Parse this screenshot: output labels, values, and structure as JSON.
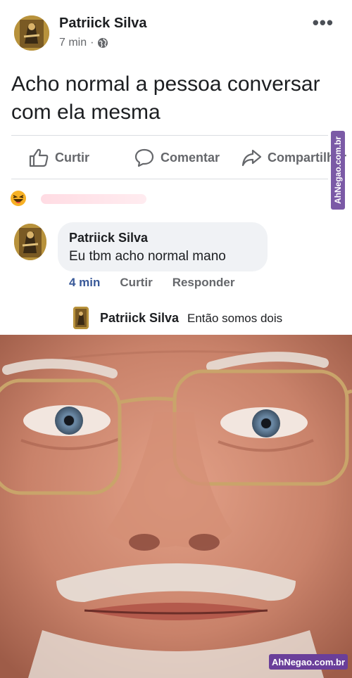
{
  "post": {
    "author": "Patriick Silva",
    "time": "7 min",
    "separator": "·",
    "text": "Acho normal a pessoa conversar com ela mesma",
    "more_icon": "more-dots-icon",
    "privacy_icon": "globe-icon"
  },
  "actions": {
    "like_label": "Curtir",
    "comment_label": "Comentar",
    "share_label": "Compartilhar"
  },
  "reactions": {
    "icon": "haha-icon"
  },
  "comment": {
    "author": "Patriick Silva",
    "text": "Eu tbm acho normal mano",
    "time": "4 min",
    "like_label": "Curtir",
    "reply_label": "Responder"
  },
  "reply": {
    "author": "Patriick Silva",
    "text": "Então somos dois"
  },
  "watermark": {
    "side": "AhNegao.com.br",
    "bottom": "AhNegao.com.br"
  },
  "colors": {
    "link_blue": "#385898",
    "muted_gray": "#65676b",
    "bubble_bg": "#f0f2f5",
    "watermark_purple": "#6a3f9a"
  }
}
